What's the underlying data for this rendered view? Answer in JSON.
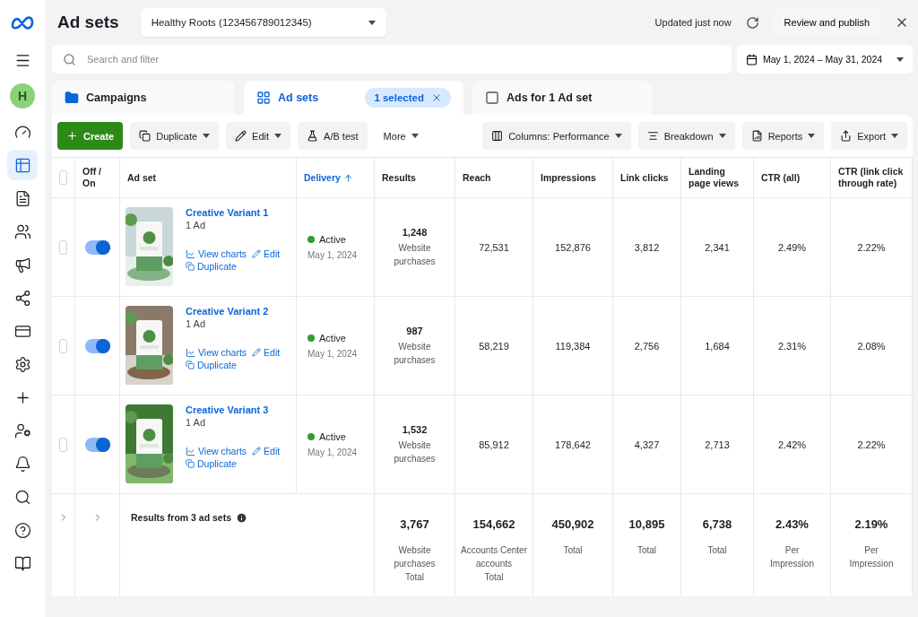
{
  "sidebar": {
    "items": [
      {
        "kind": "logo"
      },
      {
        "kind": "menu",
        "selected": false
      },
      {
        "kind": "avatar",
        "label": "H"
      },
      {
        "kind": "gauge",
        "selected": false
      },
      {
        "kind": "table",
        "selected": true
      },
      {
        "kind": "document",
        "selected": false
      },
      {
        "kind": "people",
        "selected": false
      },
      {
        "kind": "megaphone",
        "selected": false
      },
      {
        "kind": "network",
        "selected": false
      },
      {
        "kind": "card",
        "selected": false
      },
      {
        "kind": "gear",
        "selected": false
      },
      {
        "kind": "split",
        "selected": false
      },
      {
        "kind": "user-gear",
        "selected": false
      },
      {
        "kind": "bell",
        "selected": false
      },
      {
        "kind": "search",
        "selected": false
      },
      {
        "kind": "help",
        "selected": false
      },
      {
        "kind": "book",
        "selected": false
      }
    ]
  },
  "header": {
    "title": "Ad sets",
    "account": "Healthy Roots (123456789012345)",
    "updated": "Updated just now",
    "publish": "Review and publish"
  },
  "search": {
    "placeholder": "Search and filter"
  },
  "date_range": "May 1, 2024 – May 31, 2024",
  "tabs": [
    {
      "kind": "folder",
      "label": "Campaigns",
      "selected": false
    },
    {
      "kind": "grid",
      "label": "Ad sets",
      "selected": true,
      "badge": "1 selected"
    },
    {
      "kind": "square",
      "label": "Ads for 1 Ad set",
      "selected": false
    }
  ],
  "toolbar": {
    "left": [
      {
        "kind": "create",
        "label": "Create",
        "dropdown": false
      },
      {
        "kind": "duplicate",
        "label": "Duplicate",
        "dropdown": true
      },
      {
        "kind": "edit",
        "label": "Edit",
        "dropdown": true
      },
      {
        "kind": "flask",
        "label": "A/B test",
        "dropdown": false
      },
      {
        "kind": "plain",
        "label": "More",
        "dropdown": true
      }
    ],
    "right": [
      {
        "kind": "columns",
        "label": "Columns: Performance",
        "dropdown": true
      },
      {
        "kind": "breakdown",
        "label": "Breakdown",
        "dropdown": true
      },
      {
        "kind": "reports",
        "label": "Reports",
        "dropdown": true
      },
      {
        "kind": "export",
        "label": "Export",
        "dropdown": true
      }
    ]
  },
  "table": {
    "all_checked": false,
    "columns": [
      {
        "label": "Off / On",
        "sorted": false
      },
      {
        "label": "Ad set",
        "sorted": false
      },
      {
        "label": "Delivery",
        "sorted": true
      },
      {
        "label": "Results",
        "sorted": false
      },
      {
        "label": "Reach",
        "sorted": false
      },
      {
        "label": "Impressions",
        "sorted": false
      },
      {
        "label": "Link clicks",
        "sorted": false
      },
      {
        "label": "Landing page views",
        "sorted": false
      },
      {
        "label": "CTR (all)",
        "sorted": false
      },
      {
        "label": "CTR (link click through rate)",
        "sorted": false
      }
    ],
    "rows": [
      {
        "checked": false,
        "on": true,
        "name": "Creative Variant 1",
        "ads": "1 Ad",
        "actions": [
          "View charts",
          "Edit",
          "Duplicate"
        ],
        "status": "Active",
        "date": "May 1, 2024",
        "results": "1,248",
        "results_label": "Website purchases",
        "metrics": [
          "72,531",
          "152,876",
          "3,812",
          "2,341",
          "2.49%",
          "2.22%"
        ]
      },
      {
        "checked": false,
        "on": true,
        "name": "Creative Variant 2",
        "ads": "1 Ad",
        "actions": [
          "View charts",
          "Edit",
          "Duplicate"
        ],
        "status": "Active",
        "date": "May 1, 2024",
        "results": "987",
        "results_label": "Website purchases",
        "metrics": [
          "58,219",
          "119,384",
          "2,756",
          "1,684",
          "2.31%",
          "2.08%"
        ]
      },
      {
        "checked": false,
        "on": true,
        "name": "Creative Variant 3",
        "ads": "1 Ad",
        "actions": [
          "View charts",
          "Edit",
          "Duplicate"
        ],
        "status": "Active",
        "date": "May 1, 2024",
        "results": "1,532",
        "results_label": "Website purchases",
        "metrics": [
          "85,912",
          "178,642",
          "4,327",
          "2,713",
          "2.42%",
          "2.22%"
        ]
      }
    ],
    "footer": {
      "label": "Results from 3 ad sets",
      "cells": [
        {
          "value": "3,767",
          "lines": [
            "Website purchases",
            "Total"
          ]
        },
        {
          "value": "154,662",
          "lines": [
            "Accounts Center accounts",
            "Total"
          ]
        },
        {
          "value": "450,902",
          "lines": [
            "Total"
          ]
        },
        {
          "value": "10,895",
          "lines": [
            "Total"
          ]
        },
        {
          "value": "6,738",
          "lines": [
            "Total"
          ]
        },
        {
          "value": "2.43%",
          "lines": [
            "Per Impression"
          ]
        },
        {
          "value": "2.19%",
          "lines": [
            "Per Impression"
          ]
        }
      ]
    }
  }
}
